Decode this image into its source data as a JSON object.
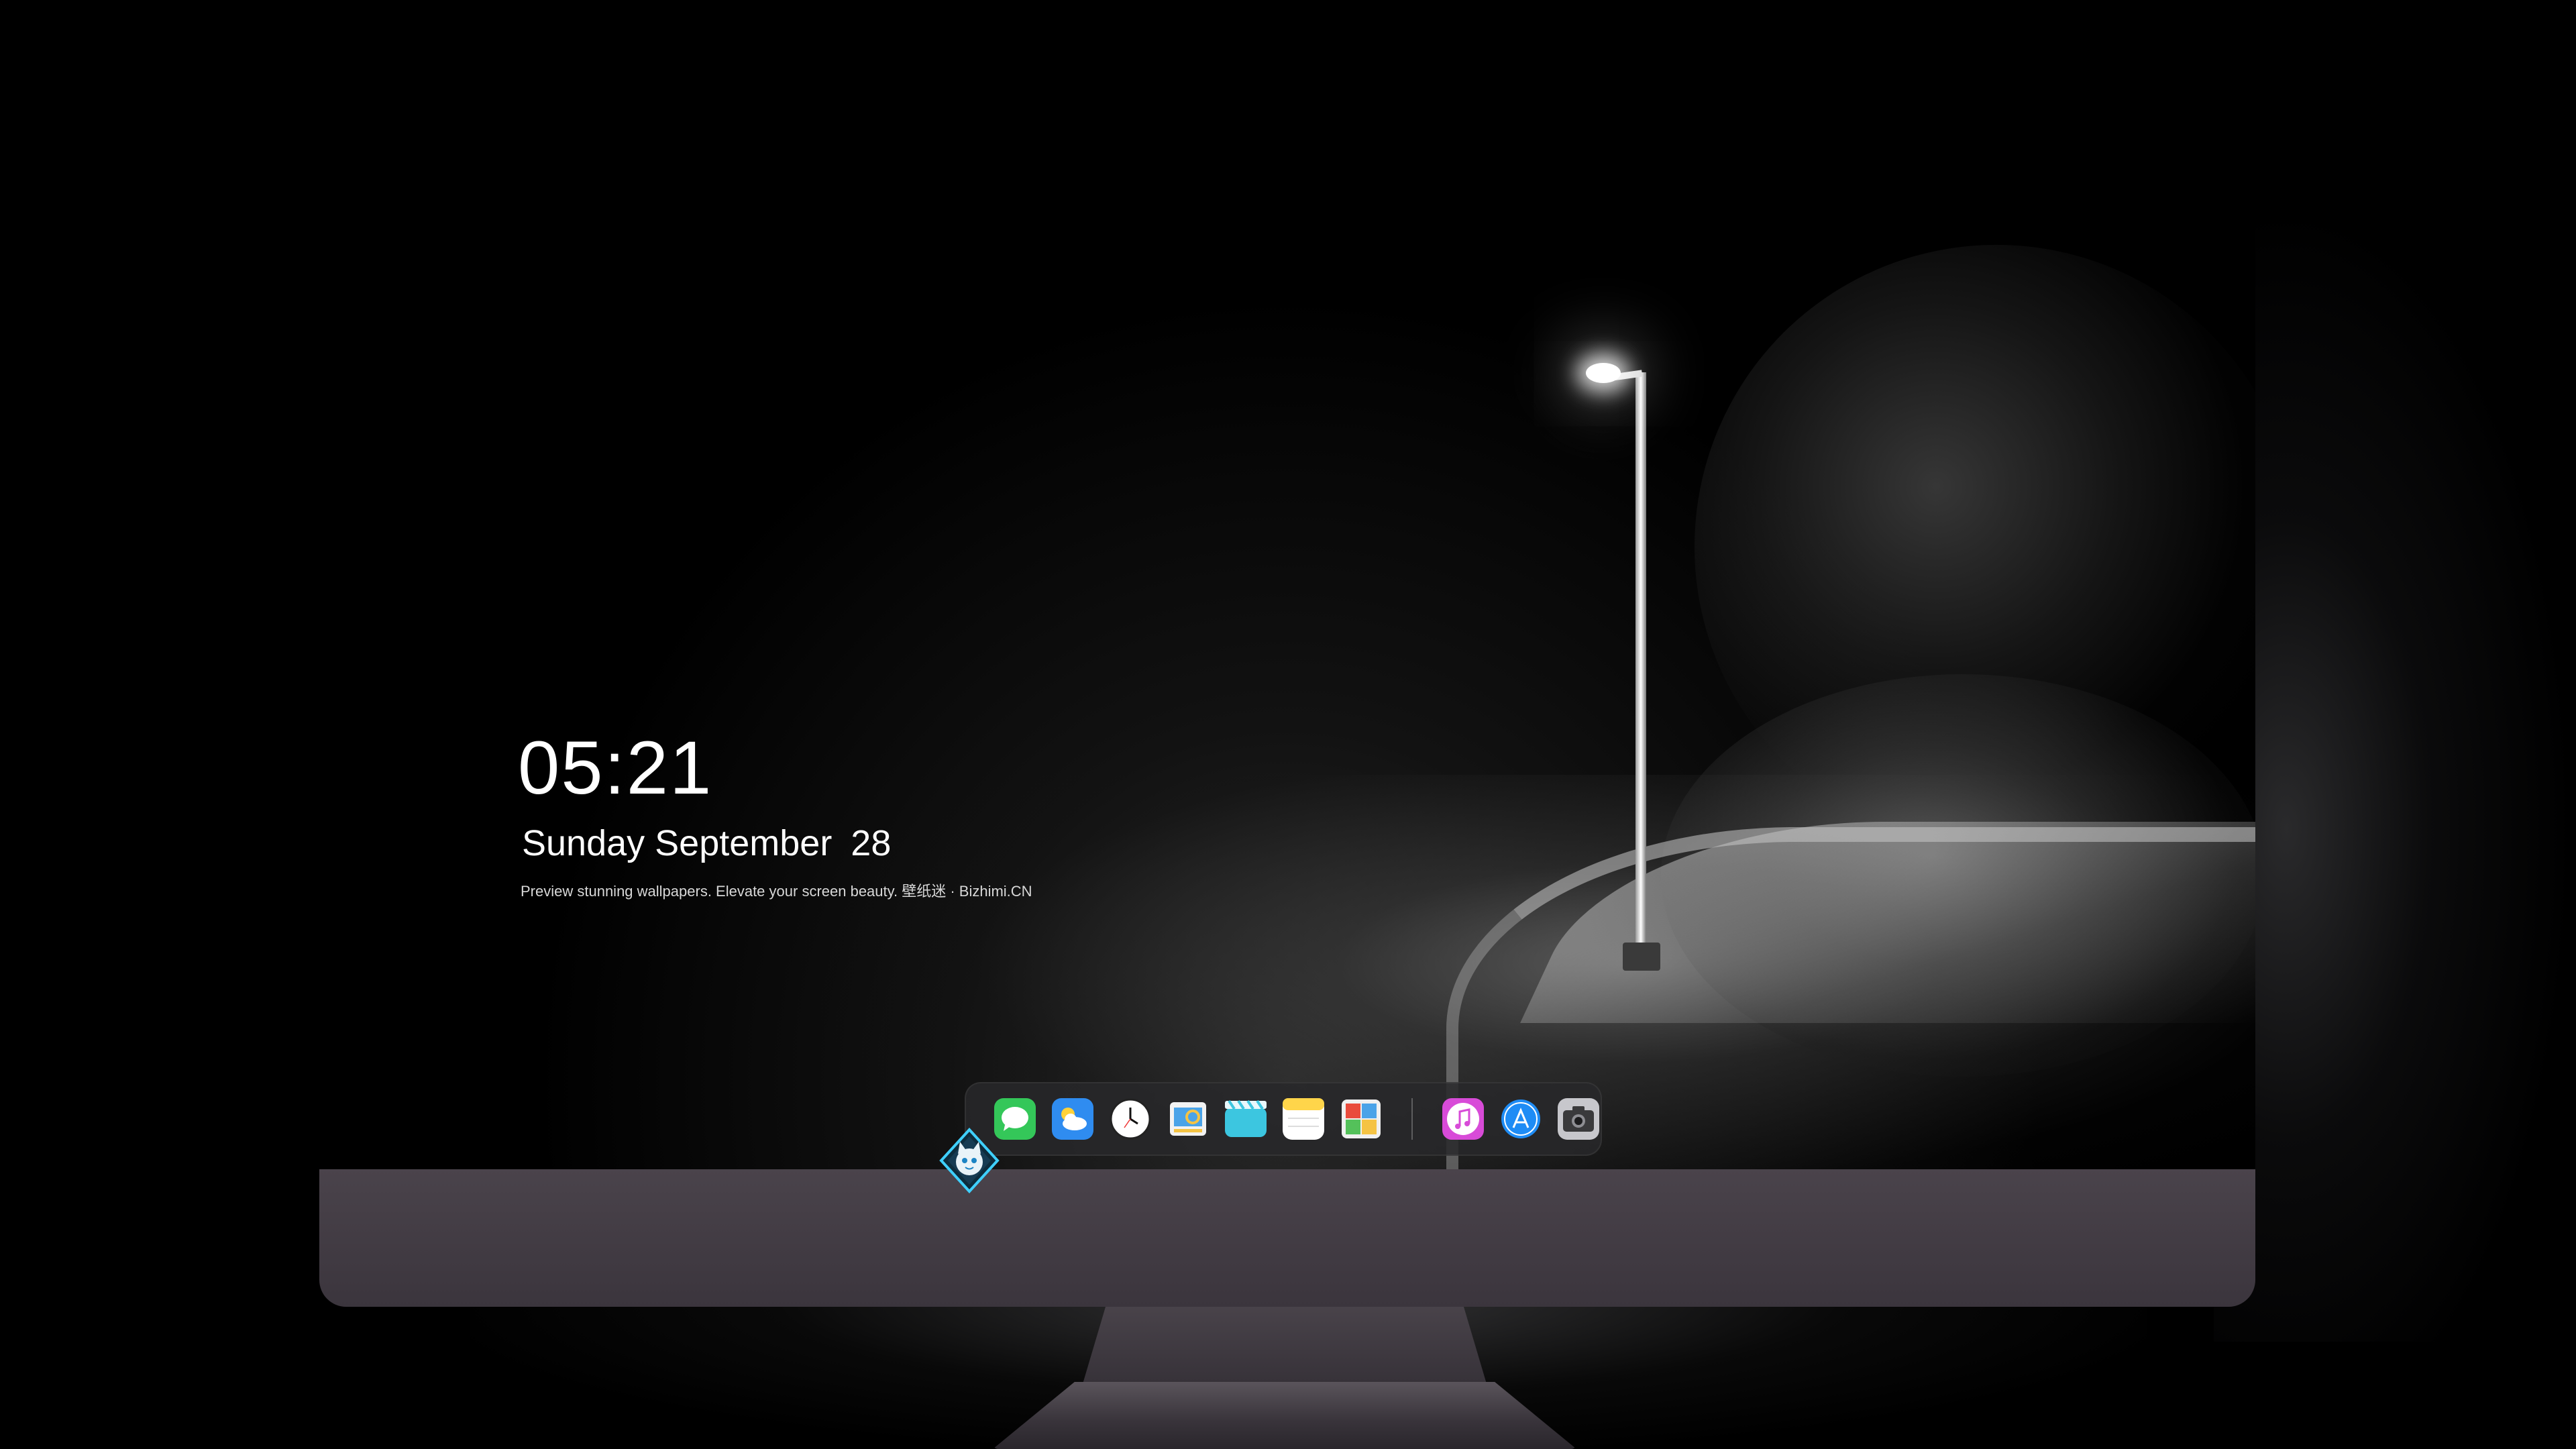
{
  "lockscreen": {
    "time": "05:21",
    "date_weekday_month": "Sunday September",
    "date_day": "28",
    "tagline": "Preview stunning wallpapers. Elevate your screen beauty. 壁纸迷 · Bizhimi.CN"
  },
  "dock": {
    "apps": [
      {
        "name": "messages-icon",
        "color": "#34c759"
      },
      {
        "name": "weather-icon",
        "color": "#2f8cf0"
      },
      {
        "name": "clock-icon",
        "color": "#ffffff"
      },
      {
        "name": "preview-icon",
        "color": "#f5c343"
      },
      {
        "name": "clips-icon",
        "color": "#3cc6e0"
      },
      {
        "name": "notes-icon",
        "color": "#ffd54a"
      },
      {
        "name": "photo-booth-icon",
        "color": "#e94b3c"
      },
      {
        "name": "itunes-icon",
        "color": "#d84bd8"
      },
      {
        "name": "app-store-icon",
        "color": "#1e8cf5"
      },
      {
        "name": "camera-icon",
        "color": "#8e8e93"
      }
    ]
  },
  "monitor": {
    "bezel_color": "#3f3942",
    "logo": "cat-mascot-logo"
  }
}
